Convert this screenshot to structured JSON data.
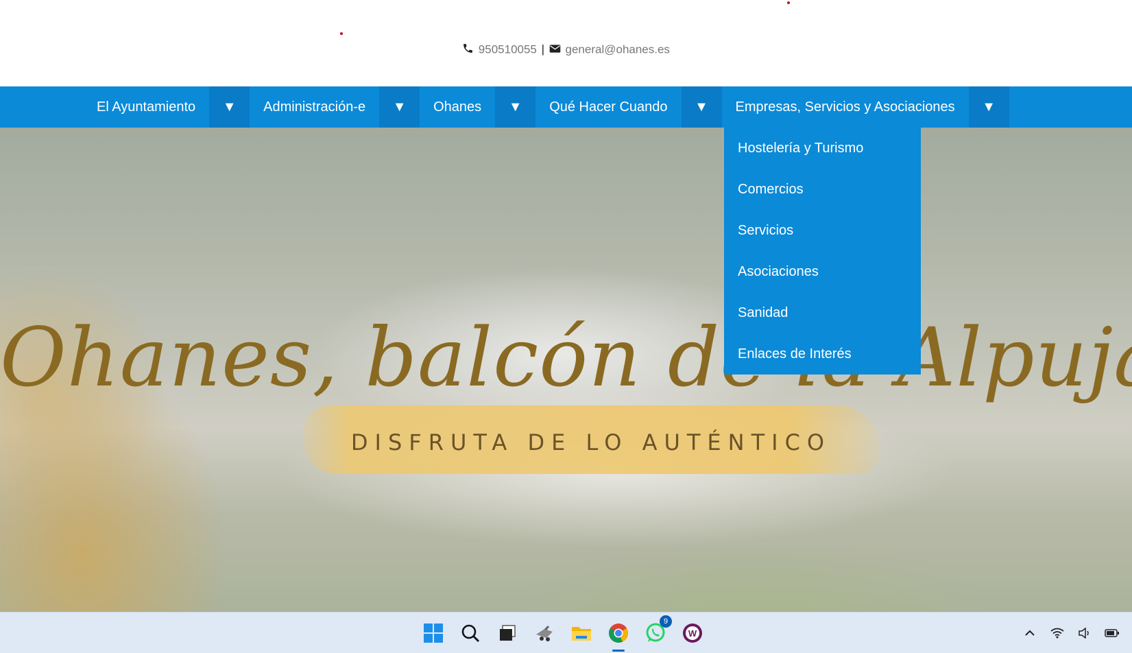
{
  "contact": {
    "phone": "950510055",
    "separator": "|",
    "email": "general@ohanes.es",
    "phone_icon": "phone-icon",
    "email_icon": "envelope-icon"
  },
  "nav": {
    "toggle_glyph": "▼",
    "items": [
      {
        "label": "El Ayuntamiento"
      },
      {
        "label": "Administración-e"
      },
      {
        "label": "Ohanes"
      },
      {
        "label": "Qué Hacer Cuando"
      },
      {
        "label": "Empresas, Servicios y Asociaciones"
      }
    ],
    "open_index": 4
  },
  "dropdown": {
    "items": [
      {
        "label": "Hostelería y Turismo"
      },
      {
        "label": "Comercios"
      },
      {
        "label": "Servicios"
      },
      {
        "label": "Asociaciones"
      },
      {
        "label": "Sanidad"
      },
      {
        "label": "Enlaces de Interés"
      }
    ]
  },
  "hero": {
    "title": "Ohanes, balcón de la Alpujarra",
    "subtitle": "DISFRUTA DE LO AUTÉNTICO"
  },
  "taskbar": {
    "apps": [
      "windows-start-icon",
      "search-icon",
      "task-view-icon",
      "app-icon",
      "file-explorer-icon",
      "chrome-icon",
      "whatsapp-icon",
      "w-app-icon"
    ],
    "whatsapp_badge": "9",
    "tray": [
      "chevron-up-icon",
      "wifi-icon",
      "volume-icon",
      "battery-icon"
    ]
  },
  "colors": {
    "nav_bg": "#0b8ad8",
    "nav_toggle_bg": "#0a7bc6",
    "hero_title": "#8a6a22",
    "hero_subtitle": "#6b5328"
  }
}
